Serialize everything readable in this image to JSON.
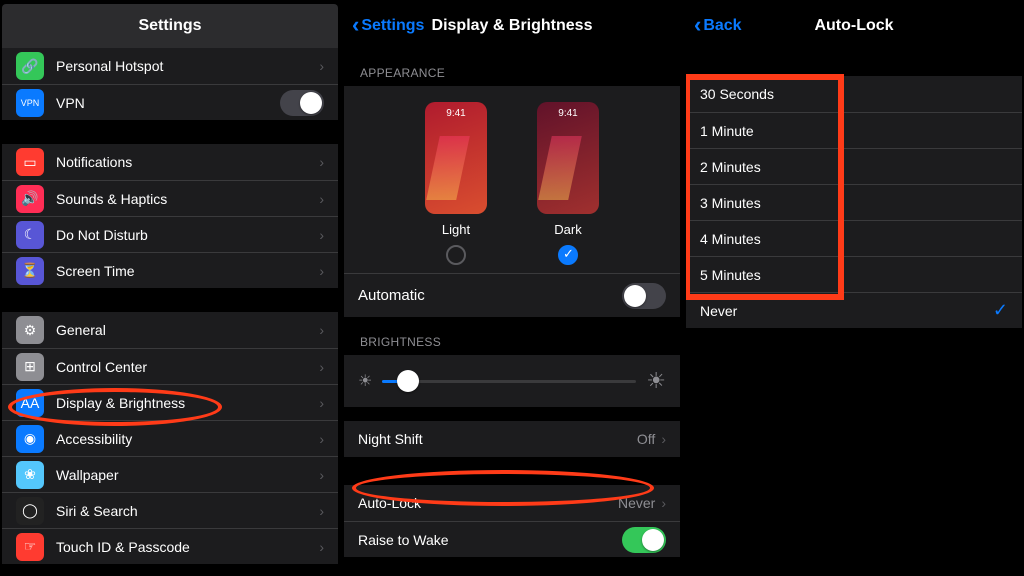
{
  "pane1": {
    "title": "Settings",
    "top": [
      {
        "label": "Personal Hotspot",
        "icon": "#34c759",
        "glyph": "🔗",
        "chev": true
      },
      {
        "label": "VPN",
        "icon": "#0a7aff",
        "glyph": "VPN",
        "toggle": true
      }
    ],
    "g1": [
      {
        "label": "Notifications",
        "icon": "#ff3b30",
        "glyph": "▭"
      },
      {
        "label": "Sounds & Haptics",
        "icon": "#ff2d55",
        "glyph": "🔊"
      },
      {
        "label": "Do Not Disturb",
        "icon": "#5856d6",
        "glyph": "☾"
      },
      {
        "label": "Screen Time",
        "icon": "#5856d6",
        "glyph": "⏳"
      }
    ],
    "g2": [
      {
        "label": "General",
        "icon": "#8e8e93",
        "glyph": "⚙"
      },
      {
        "label": "Control Center",
        "icon": "#8e8e93",
        "glyph": "⊞"
      },
      {
        "label": "Display & Brightness",
        "icon": "#0a7aff",
        "glyph": "AA"
      },
      {
        "label": "Accessibility",
        "icon": "#0a7aff",
        "glyph": "◉"
      },
      {
        "label": "Wallpaper",
        "icon": "#54c7fc",
        "glyph": "❀"
      },
      {
        "label": "Siri & Search",
        "icon": "#222",
        "glyph": "◯"
      },
      {
        "label": "Touch ID & Passcode",
        "icon": "#ff3b30",
        "glyph": "☞"
      }
    ]
  },
  "pane2": {
    "back": "Settings",
    "title": "Display & Brightness",
    "sec_appearance": "Appearance",
    "time": "9:41",
    "light": "Light",
    "dark": "Dark",
    "automatic": "Automatic",
    "sec_brightness": "Brightness",
    "night_shift": "Night Shift",
    "night_shift_val": "Off",
    "auto_lock": "Auto-Lock",
    "auto_lock_val": "Never",
    "raise": "Raise to Wake"
  },
  "pane3": {
    "back": "Back",
    "title": "Auto-Lock",
    "options": [
      "30 Seconds",
      "1 Minute",
      "2 Minutes",
      "3 Minutes",
      "4 Minutes",
      "5 Minutes",
      "Never"
    ],
    "selected": "Never"
  }
}
